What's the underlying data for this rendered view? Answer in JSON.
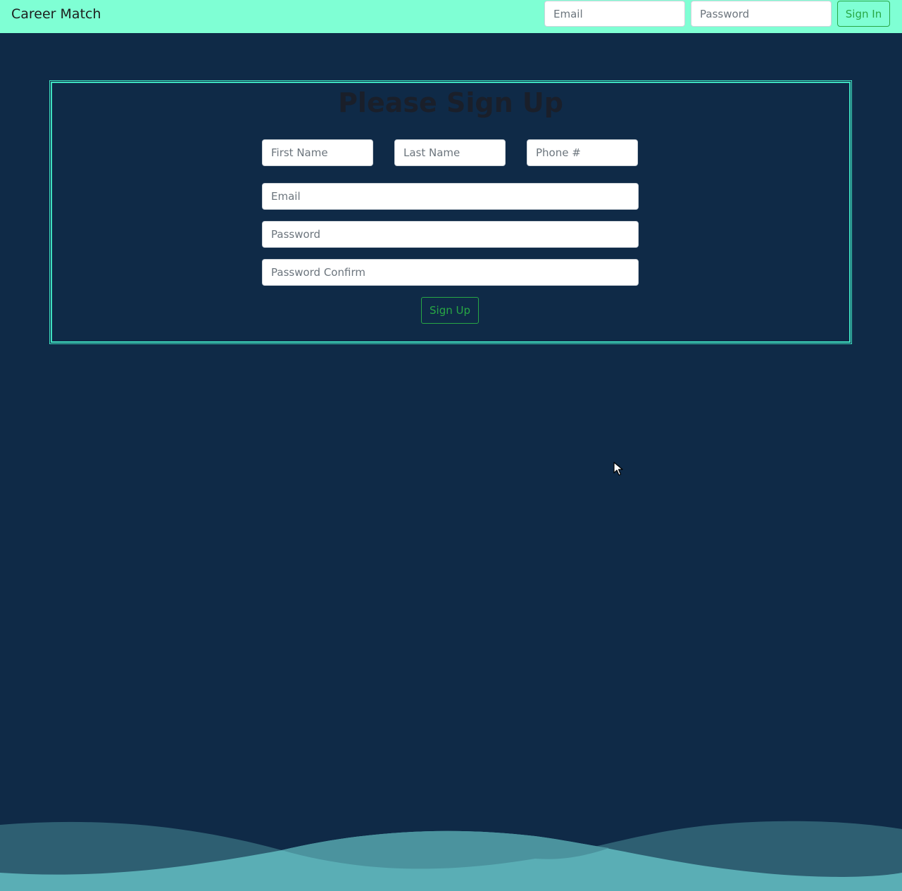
{
  "navbar": {
    "brand": "Career Match",
    "email_placeholder": "Email",
    "password_placeholder": "Password",
    "signin_label": "Sign In"
  },
  "signup": {
    "title": "Please Sign Up",
    "first_name_placeholder": "First Name",
    "last_name_placeholder": "Last Name",
    "phone_placeholder": "Phone #",
    "email_placeholder": "Email",
    "password_placeholder": "Password",
    "password_confirm_placeholder": "Password Confirm",
    "submit_label": "Sign Up"
  },
  "colors": {
    "navbar_bg": "#7fffd4",
    "page_bg": "#0f2a47",
    "panel_border": "#3fe0c0",
    "button_accent": "#28a745",
    "wave_dark": "#2e5f72",
    "wave_light": "#5aaeb5"
  },
  "icons": {
    "cursor": "mouse-pointer-icon"
  }
}
